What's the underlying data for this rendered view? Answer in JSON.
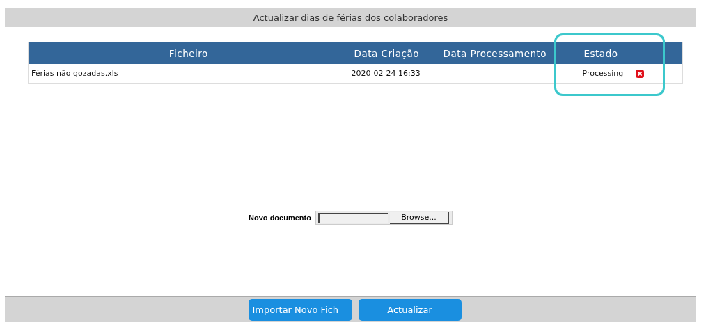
{
  "window": {
    "title": "Actualizar dias de férias dos colaboradores"
  },
  "table": {
    "columns": [
      "Ficheiro",
      "Data Criação",
      "Data Processamento",
      "Estado"
    ],
    "rows": [
      {
        "file": "Férias não gozadas.xls",
        "created": "2020-02-24 16:33",
        "processed": "",
        "status": "Processing",
        "has_error": true
      }
    ]
  },
  "upload": {
    "label": "Novo documento",
    "browse": "Browse..."
  },
  "highlight": {
    "shown": true
  },
  "buttons": [
    "Importar Novo Fich",
    "Actualizar"
  ]
}
